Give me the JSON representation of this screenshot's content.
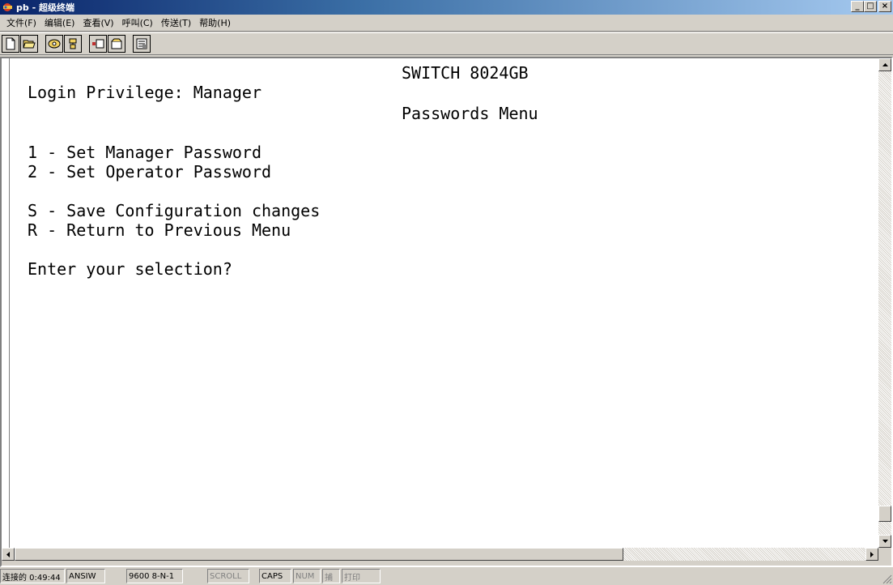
{
  "window": {
    "title": "pb - 超级终端",
    "minimize_label": "_",
    "maximize_label": "□",
    "close_label": "×"
  },
  "menu": {
    "items": [
      "文件(F)",
      "编辑(E)",
      "查看(V)",
      "呼叫(C)",
      "传送(T)",
      "帮助(H)"
    ]
  },
  "toolbar": {
    "icons": [
      "new-icon",
      "open-icon",
      "call-icon",
      "disconnect-icon",
      "send-icon",
      "receive-icon",
      "properties-icon"
    ]
  },
  "terminal": {
    "lines": [
      "SWITCH 8024GB",
      "Login Privilege: Manager",
      "Passwords Menu",
      "1 - Set Manager Password",
      "2 - Set Operator Password",
      "S - Save Configuration changes",
      "R - Return to Previous Menu",
      "Enter your selection?"
    ]
  },
  "status": {
    "connected": "连接的 0:49:44",
    "emulation": "ANSIW",
    "port_settings": "9600 8-N-1",
    "scroll": "SCROLL",
    "caps": "CAPS",
    "num": "NUM",
    "capture": "捕",
    "print": "打印"
  },
  "colors": {
    "title_start": "#0a246a",
    "title_end": "#a6caf0",
    "chrome": "#d4d0c8",
    "terminal_bg": "#ffffff"
  }
}
